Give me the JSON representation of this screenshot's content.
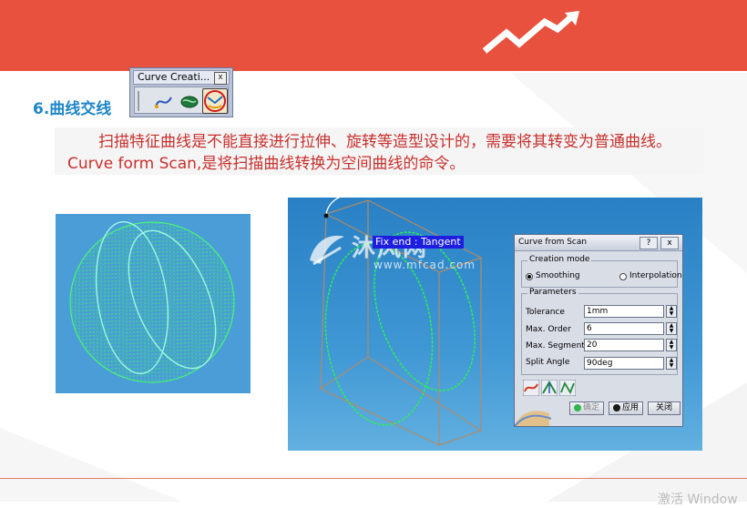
{
  "colors": {
    "banner": "#e9513f",
    "section_title": "#1f86c8",
    "description_text": "#c8302d",
    "cad_background": "#2f8bcb",
    "curve_green": "#2cf052"
  },
  "section": {
    "title": "6.曲线交线"
  },
  "toolbar": {
    "title": "Curve Creati...",
    "close_label": "x",
    "icons": [
      "curve-connect-icon",
      "curve-scan-icon",
      "curve-from-scan-icon"
    ]
  },
  "description": {
    "text": "扫描特征曲线是不能直接进行拉伸、旋转等造型设计的，需要将其转变为普通曲线。Curve form Scan,是将扫描曲线转换为空间曲线的命令。"
  },
  "viewport": {
    "highlight_label": "Fix end : Tangent",
    "watermark_cn": "沐风网",
    "watermark_url": "www.mfcad.com"
  },
  "dialog": {
    "title": "Curve from Scan",
    "help_label": "?",
    "close_label": "x",
    "creation_mode": {
      "legend": "Creation mode",
      "options": [
        {
          "label": "Smoothing",
          "selected": true
        },
        {
          "label": "Interpolation",
          "selected": false
        }
      ]
    },
    "parameters": {
      "legend": "Parameters",
      "fields": [
        {
          "label": "Tolerance",
          "value": "1mm"
        },
        {
          "label": "Max. Order",
          "value": "6"
        },
        {
          "label": "Max. Segments",
          "value": "20"
        },
        {
          "label": "Split Angle",
          "value": "90deg"
        }
      ]
    },
    "buttons": {
      "ok": "确定",
      "apply": "应用",
      "close": "关闭"
    }
  },
  "footer": {
    "activate_text": "激活 Window"
  }
}
